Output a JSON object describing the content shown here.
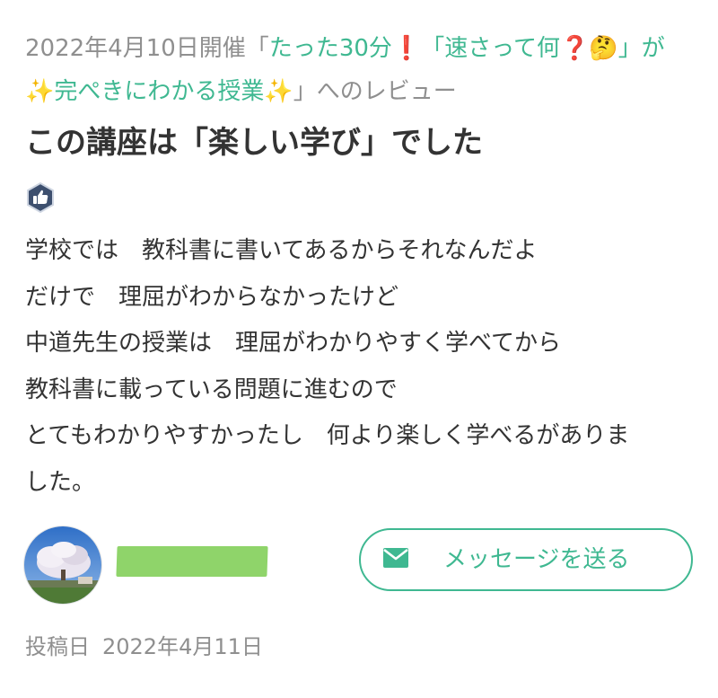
{
  "review_header": {
    "event_date": "2022年4月10日開催",
    "open_quote": "「",
    "course_title_a": "たった30分",
    "course_emoji_a": "❗",
    "course_title_b": "「速さって何",
    "course_emoji_b": "❓",
    "course_emoji_c": "🤔",
    "course_title_c": "」が",
    "sparkle_1": "✨",
    "course_title_d": "完ぺきにわかる授業",
    "sparkle_2": "✨",
    "close_quote": "」",
    "suffix": "へのレビュー"
  },
  "review": {
    "headline": "この講座は「楽しい学び」でした",
    "badge_icon": "thumbs-up-icon",
    "body_lines": [
      "学校では　教科書に書いてあるからそれなんだよ",
      "だけで　理屈がわからなかったけど",
      "中道先生の授業は　理屈がわかりやすく学べてから",
      "教科書に載っている問題に進むので",
      "とてもわかりやすかったし　何より楽しく学べるがありま",
      "した。"
    ]
  },
  "reviewer": {
    "avatar_icon": "cherry-blossom-tree-photo",
    "name_redaction_color": "#8fd46a"
  },
  "actions": {
    "message_button_label": "メッセージを送る",
    "message_icon": "mail-icon"
  },
  "footer": {
    "posted_label": "投稿日",
    "posted_date": "2022年4月11日"
  },
  "colors": {
    "accent": "#3fb891",
    "muted": "#8f8f8f",
    "text": "#333333",
    "alert_red": "#e0262b",
    "badge_navy": "#3d4f6e"
  }
}
